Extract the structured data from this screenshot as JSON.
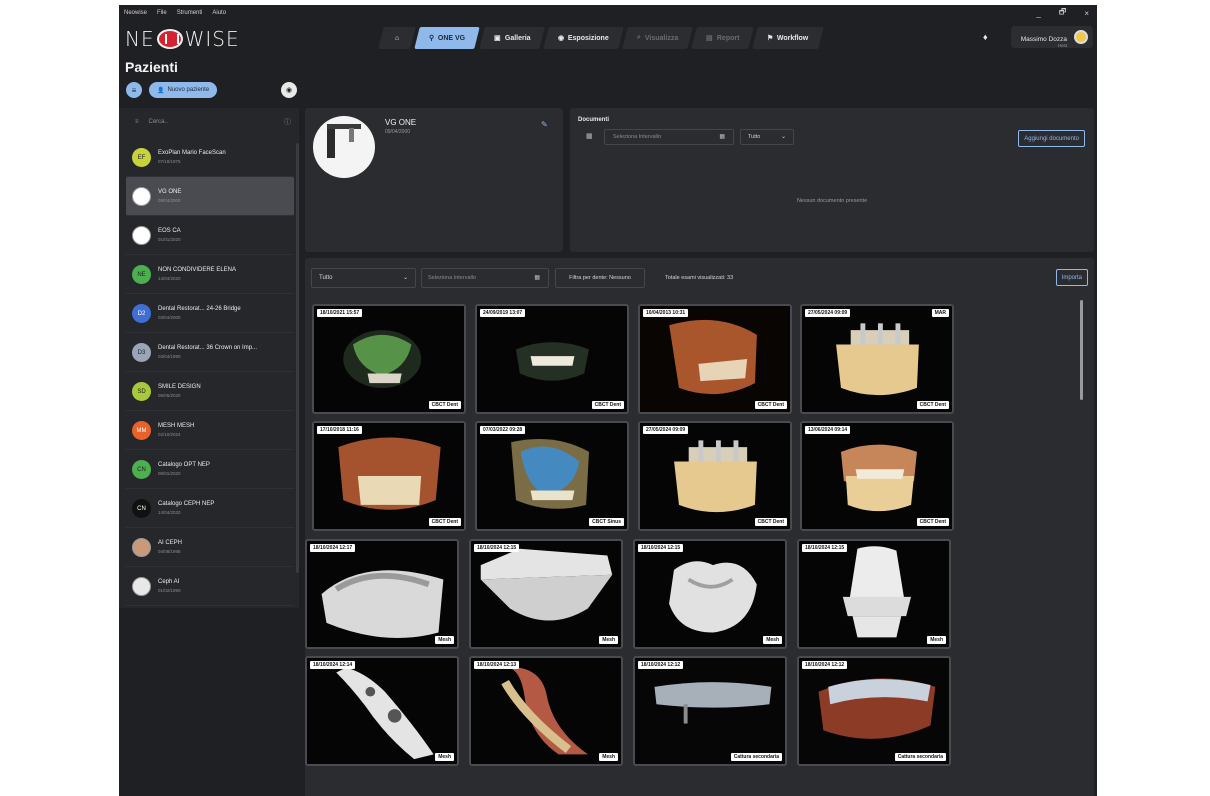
{
  "menubar": {
    "items": [
      "Neowise",
      "File",
      "Strumenti",
      "Aiuto"
    ]
  },
  "window_controls": {
    "minimize": "_",
    "restore": "🗗",
    "close": "×"
  },
  "logo": {
    "left": "NE",
    "right": "WISE"
  },
  "nav": {
    "tabs": [
      {
        "label": "",
        "icon": "home-icon"
      },
      {
        "label": "ONE VG",
        "icon": "patient-icon",
        "active": true
      },
      {
        "label": "Galleria",
        "icon": "gallery-icon"
      },
      {
        "label": "Esposizione",
        "icon": "exposure-icon"
      },
      {
        "label": "Visualizza",
        "icon": "search-icon",
        "disabled": true
      },
      {
        "label": "Report",
        "icon": "report-icon",
        "disabled": true
      },
      {
        "label": "Workflow",
        "icon": "workflow-icon"
      }
    ]
  },
  "user": {
    "name": "Massimo Dozza",
    "role": "Host"
  },
  "page": {
    "title": "Pazienti",
    "new_patient": "Nuovo paziente"
  },
  "sidebar": {
    "search_placeholder": "Cerca..",
    "patients": [
      {
        "initials": "EF",
        "name": "ExoPlan Mario FaceScan",
        "date": "07/10/1975",
        "color": "#c8d33a"
      },
      {
        "initials": "",
        "name": "VG ONE",
        "date": "09/04/2000",
        "color": "#ffffff",
        "photo": true,
        "selected": true
      },
      {
        "initials": "",
        "name": "EOS CA",
        "date": "01/01/2020",
        "color": "#ffffff",
        "photo": true
      },
      {
        "initials": "NE",
        "name": "NON CONDIVIDERE ELENA",
        "date": "14/04/2020",
        "color": "#4caf50"
      },
      {
        "initials": "D2",
        "name": "Dental Restorat... 24-26 Bridge",
        "date": "03/04/2000",
        "color": "#3f6fd6"
      },
      {
        "initials": "D3",
        "name": "Dental Restorat... 36 Crown on Imp...",
        "date": "03/04/1990",
        "color": "#9aa5b8"
      },
      {
        "initials": "SD",
        "name": "SMILE DESIGN",
        "date": "06/05/2020",
        "color": "#a7c93a"
      },
      {
        "initials": "MM",
        "name": "MESH MESH",
        "date": "02/10/2024",
        "color": "#e8622a"
      },
      {
        "initials": "CN",
        "name": "Catalogo OPT NEP",
        "date": "08/01/2020",
        "color": "#4caf50"
      },
      {
        "initials": "CN",
        "name": "Catalogo CEPH NEP",
        "date": "14/04/2020",
        "color": "#111111"
      },
      {
        "initials": "",
        "name": "AI CEPH",
        "date": "04/08/1998",
        "color": "#c99a7a",
        "photo": true
      },
      {
        "initials": "",
        "name": "Ceph AI",
        "date": "01/02/1990",
        "color": "#e8e8e8",
        "photo": true
      }
    ]
  },
  "patient_card": {
    "name": "VG ONE",
    "date": "09/04/2000"
  },
  "documents": {
    "title": "Documenti",
    "range_placeholder": "Seleziona Intervallo",
    "filter": "Tutto",
    "add_button": "Aggiungi documento",
    "empty": "Nessun documento presente"
  },
  "exams": {
    "filter": "Tutto",
    "range_placeholder": "Seleziona Intervallo",
    "tooth_filter": "Filtra per dente: Nessuno",
    "total": "Totale esami visualizzati: 33",
    "import_button": "Importa",
    "tiles": [
      {
        "date": "18/10/2021 15:57",
        "label": "CBCT Dent",
        "kind": "cbct-green"
      },
      {
        "date": "24/09/2019 13:07",
        "label": "CBCT Dent",
        "kind": "cbct-dark"
      },
      {
        "date": "10/04/2013 10:31",
        "label": "CBCT Dent",
        "kind": "cbct-skull"
      },
      {
        "date": "27/05/2024 09:09",
        "label": "CBCT Dent",
        "kind": "cbct-jaw",
        "tag": "MAR"
      },
      {
        "date": "17/10/2018 11:16",
        "label": "CBCT Dent",
        "kind": "cbct-teeth"
      },
      {
        "date": "07/03/2022 09:28",
        "label": "CBCT Sinus",
        "kind": "cbct-sinus"
      },
      {
        "date": "27/05/2024 09:09",
        "label": "CBCT Dent",
        "kind": "cbct-jaw"
      },
      {
        "date": "13/06/2024 09:14",
        "label": "CBCT Dent",
        "kind": "cbct-jaw2"
      },
      {
        "date": "18/10/2024 12:17",
        "label": "Mesh",
        "kind": "mesh-arch"
      },
      {
        "date": "18/10/2024 12:15",
        "label": "Mesh",
        "kind": "mesh-block"
      },
      {
        "date": "18/10/2024 12:15",
        "label": "Mesh",
        "kind": "mesh-crown"
      },
      {
        "date": "18/10/2024 12:15",
        "label": "Mesh",
        "kind": "mesh-abutment"
      },
      {
        "date": "18/10/2024 12:14",
        "label": "Mesh",
        "kind": "mesh-bar"
      },
      {
        "date": "18/10/2024 12:13",
        "label": "Mesh",
        "kind": "mesh-color-arch"
      },
      {
        "date": "18/10/2024 12:12",
        "label": "Cattura secondaria",
        "kind": "capture-bridge"
      },
      {
        "date": "18/10/2024 12:12",
        "label": "Cattura secondaria",
        "kind": "capture-jaw"
      }
    ]
  }
}
